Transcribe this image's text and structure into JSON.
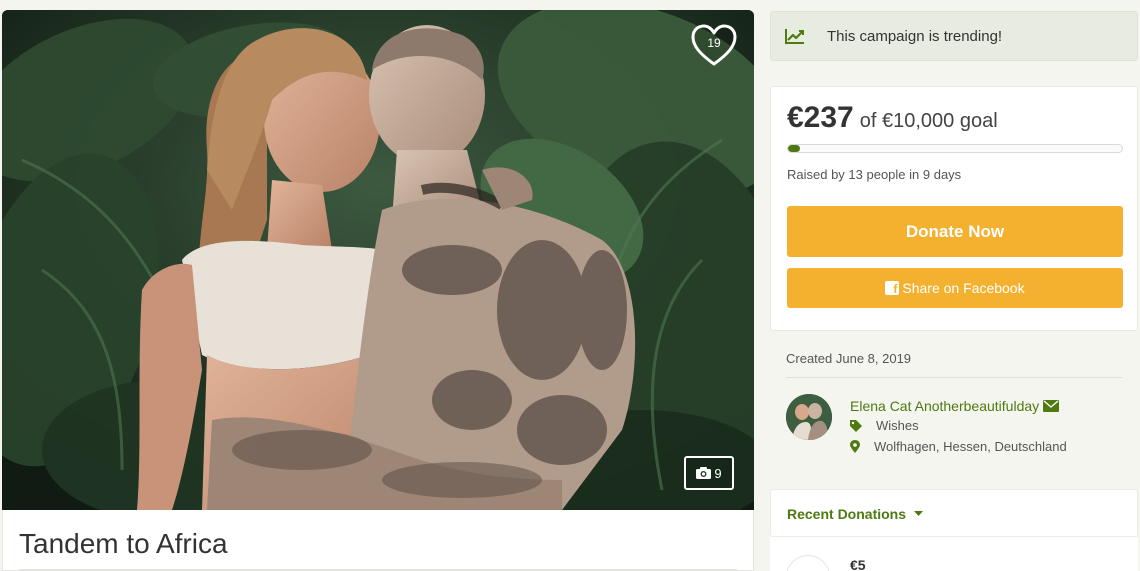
{
  "campaign": {
    "title": "Tandem to Africa",
    "favorite_count": "19",
    "photo_count": "9"
  },
  "trending": {
    "text": "This campaign is trending!",
    "icon": "trending-chart-icon"
  },
  "progress": {
    "amount": "€237",
    "goal_text": "of €10,000 goal",
    "fraction": 0.0237,
    "raised_text": "Raised by 13 people in 9 days"
  },
  "actions": {
    "donate_label": "Donate Now",
    "share_label": "Share on Facebook"
  },
  "meta": {
    "created": "Created June 8, 2019"
  },
  "organizer": {
    "name": "Elena Cat Anotherbeautifulday",
    "category": "Wishes",
    "location": "Wolfhagen, Hessen, Deutschland"
  },
  "recent": {
    "title": "Recent Donations",
    "first_amount": "€5"
  },
  "colors": {
    "accent_green": "#4e7a11",
    "button_orange": "#f4b130",
    "trend_bg": "#e8ebdf"
  }
}
